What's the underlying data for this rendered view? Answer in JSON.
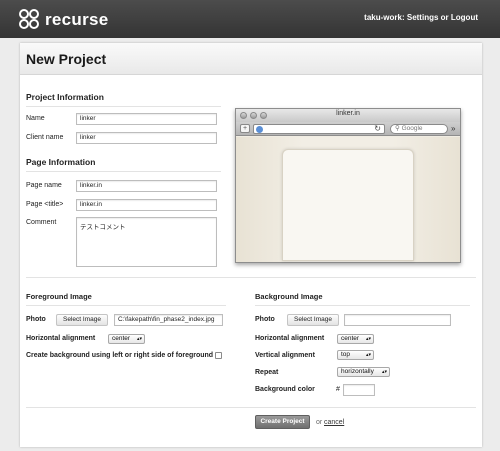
{
  "header": {
    "brand": "recurse",
    "username": "taku-work:",
    "settings_link": "Settings",
    "or": "or",
    "logout_link": "Logout"
  },
  "page": {
    "title": "New Project"
  },
  "project_info": {
    "heading": "Project Information",
    "name_label": "Name",
    "name_value": "linker",
    "client_label": "Client name",
    "client_value": "linker"
  },
  "page_info": {
    "heading": "Page Information",
    "page_name_label": "Page name",
    "page_name_value": "linker.in",
    "page_title_label": "Page <title>",
    "page_title_value": "linker.in",
    "comment_label": "Comment",
    "comment_value": "テストコメント"
  },
  "preview": {
    "window_title": "linker.in",
    "search_placeholder": "Google"
  },
  "foreground": {
    "heading": "Foreground Image",
    "photo_label": "Photo",
    "select_button": "Select Image",
    "file_value": "C:\\fakepath\\fin_phase2_index.jpg",
    "halign_label": "Horizontal alignment",
    "halign_value": "center",
    "checkbox_label": "Create background using left or right side of foreground",
    "checkbox_checked": false
  },
  "background": {
    "heading": "Background Image",
    "photo_label": "Photo",
    "select_button": "Select Image",
    "file_value": "",
    "halign_label": "Horizontal alignment",
    "halign_value": "center",
    "valign_label": "Vertical alignment",
    "valign_value": "top",
    "repeat_label": "Repeat",
    "repeat_value": "horizontally",
    "color_label": "Background color",
    "color_prefix": "#",
    "color_value": ""
  },
  "actions": {
    "create_button": "Create Project",
    "or": "or",
    "cancel_link": "cancel"
  }
}
